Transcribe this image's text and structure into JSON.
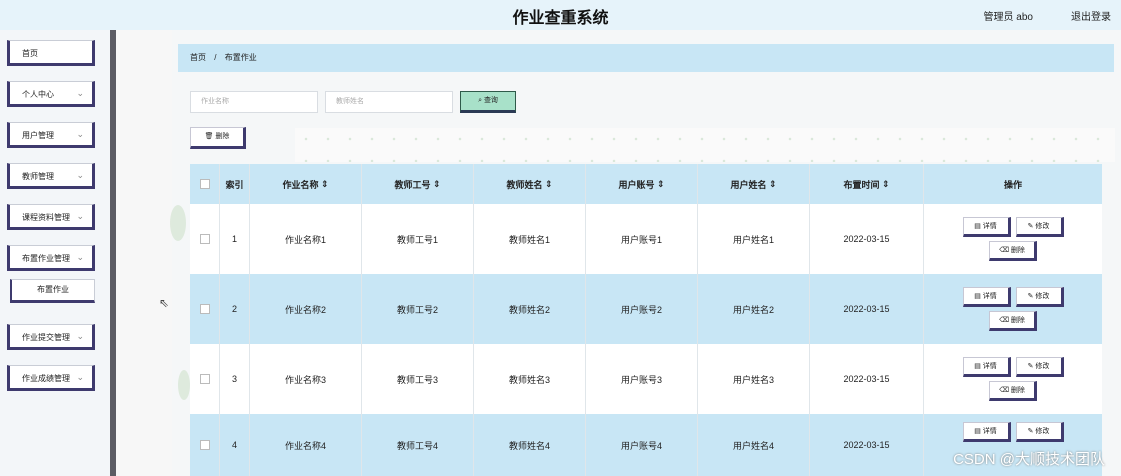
{
  "header": {
    "title": "作业查重系统",
    "admin": "管理员 abo",
    "logout": "退出登录"
  },
  "sidebar": {
    "items": [
      {
        "label": "首页"
      },
      {
        "label": "个人中心"
      },
      {
        "label": "用户管理"
      },
      {
        "label": "教师管理"
      },
      {
        "label": "课程资料管理"
      },
      {
        "label": "布置作业管理"
      },
      {
        "label": "布置作业"
      },
      {
        "label": "作业提交管理"
      },
      {
        "label": "作业成绩管理"
      }
    ]
  },
  "breadcrumb": {
    "home": "首页",
    "sep": "/",
    "current": "布置作业"
  },
  "search": {
    "name_placeholder": "作业名称",
    "teacher_placeholder": "教师姓名",
    "button": "查询"
  },
  "toolbar": {
    "delete": "删除"
  },
  "table": {
    "headers": [
      "索引",
      "作业名称",
      "教师工号",
      "教师姓名",
      "用户账号",
      "用户姓名",
      "布置时间",
      "操作"
    ],
    "rows": [
      {
        "index": "1",
        "name": "作业名称1",
        "tid": "教师工号1",
        "tname": "教师姓名1",
        "uid": "用户账号1",
        "uname": "用户姓名1",
        "time": "2022-03-15"
      },
      {
        "index": "2",
        "name": "作业名称2",
        "tid": "教师工号2",
        "tname": "教师姓名2",
        "uid": "用户账号2",
        "uname": "用户姓名2",
        "time": "2022-03-15"
      },
      {
        "index": "3",
        "name": "作业名称3",
        "tid": "教师工号3",
        "tname": "教师姓名3",
        "uid": "用户账号3",
        "uname": "用户姓名3",
        "time": "2022-03-15"
      },
      {
        "index": "4",
        "name": "作业名称4",
        "tid": "教师工号4",
        "tname": "教师姓名4",
        "uid": "用户账号4",
        "uname": "用户姓名4",
        "time": "2022-03-15"
      }
    ],
    "ops": {
      "detail": "详情",
      "edit": "修改",
      "delete": "删除"
    }
  },
  "watermark": "CSDN @大顺技术团队"
}
